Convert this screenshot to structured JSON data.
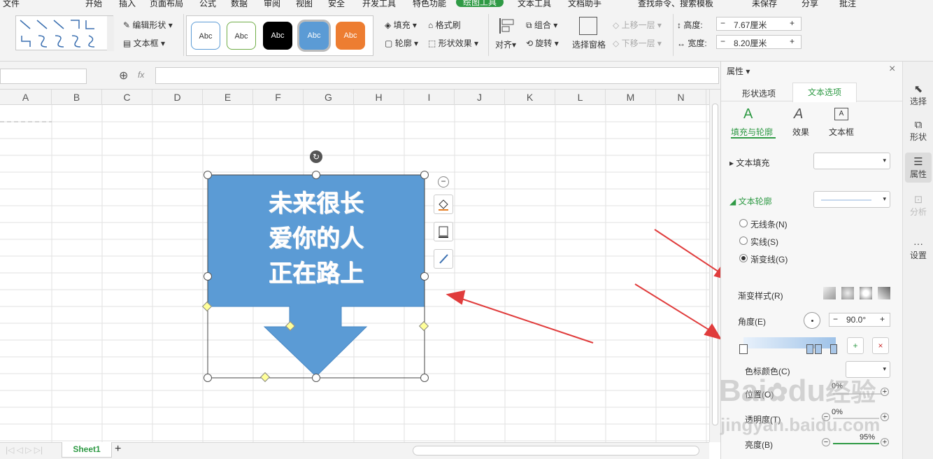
{
  "menu": {
    "file": "文件",
    "items": [
      "开始",
      "插入",
      "页面布局",
      "公式",
      "数据",
      "审阅",
      "视图",
      "安全",
      "开发工具",
      "特色功能"
    ],
    "active_tab": "绘图工具",
    "after": [
      "文本工具",
      "文档助手"
    ],
    "search": "查找命令、搜索模板",
    "unsaved": "未保存",
    "share": "分享",
    "comment": "批注"
  },
  "ribbon": {
    "edit_shape": "编辑形状",
    "textbox": "文本框",
    "style_label": "Abc",
    "fill": "填充",
    "format_painter": "格式刷",
    "outline": "轮廓",
    "shape_effects": "形状效果",
    "align": "对齐",
    "group": "组合",
    "rotate": "旋转",
    "selection_pane": "选择窗格",
    "bring_forward": "上移一层",
    "send_backward": "下移一层",
    "height_label": "高度:",
    "height_value": "7.67厘米",
    "width_label": "宽度:",
    "width_value": "8.20厘米",
    "fx": "fx"
  },
  "columns": [
    "A",
    "B",
    "C",
    "D",
    "E",
    "F",
    "G",
    "H",
    "I",
    "J",
    "K",
    "L",
    "M",
    "N"
  ],
  "shape": {
    "lines": [
      "未来很长",
      "爱你的人",
      "正在路上"
    ],
    "fill_color": "#5b9bd5"
  },
  "sheet": {
    "tab": "Sheet1",
    "add": "+"
  },
  "pane": {
    "title": "属性",
    "tab_shape": "形状选项",
    "tab_text": "文本选项",
    "sub_fill_outline": "填充与轮廓",
    "sub_effects": "效果",
    "sub_textbox": "文本框",
    "text_fill": "文本填充",
    "text_outline": "文本轮廓",
    "opt_none": "无线条(N)",
    "opt_solid": "实线(S)",
    "opt_gradient": "渐变线(G)",
    "gradient_style": "渐变样式(R)",
    "angle": "角度(E)",
    "angle_value": "90.0°",
    "stop_color": "色标颜色(C)",
    "position": "位置(O)",
    "position_value": "0%",
    "transparency": "透明度(T)",
    "transparency_value": "0%",
    "brightness": "亮度(B)",
    "brightness_value": "95%",
    "accent": "#2f9a45"
  },
  "sidebar": [
    "选择",
    "形状",
    "属性",
    "分析",
    "设置"
  ],
  "watermark": {
    "main": "Bai",
    "du": "du",
    "cn": "经验",
    "url": "jingyan.baidu.com"
  }
}
